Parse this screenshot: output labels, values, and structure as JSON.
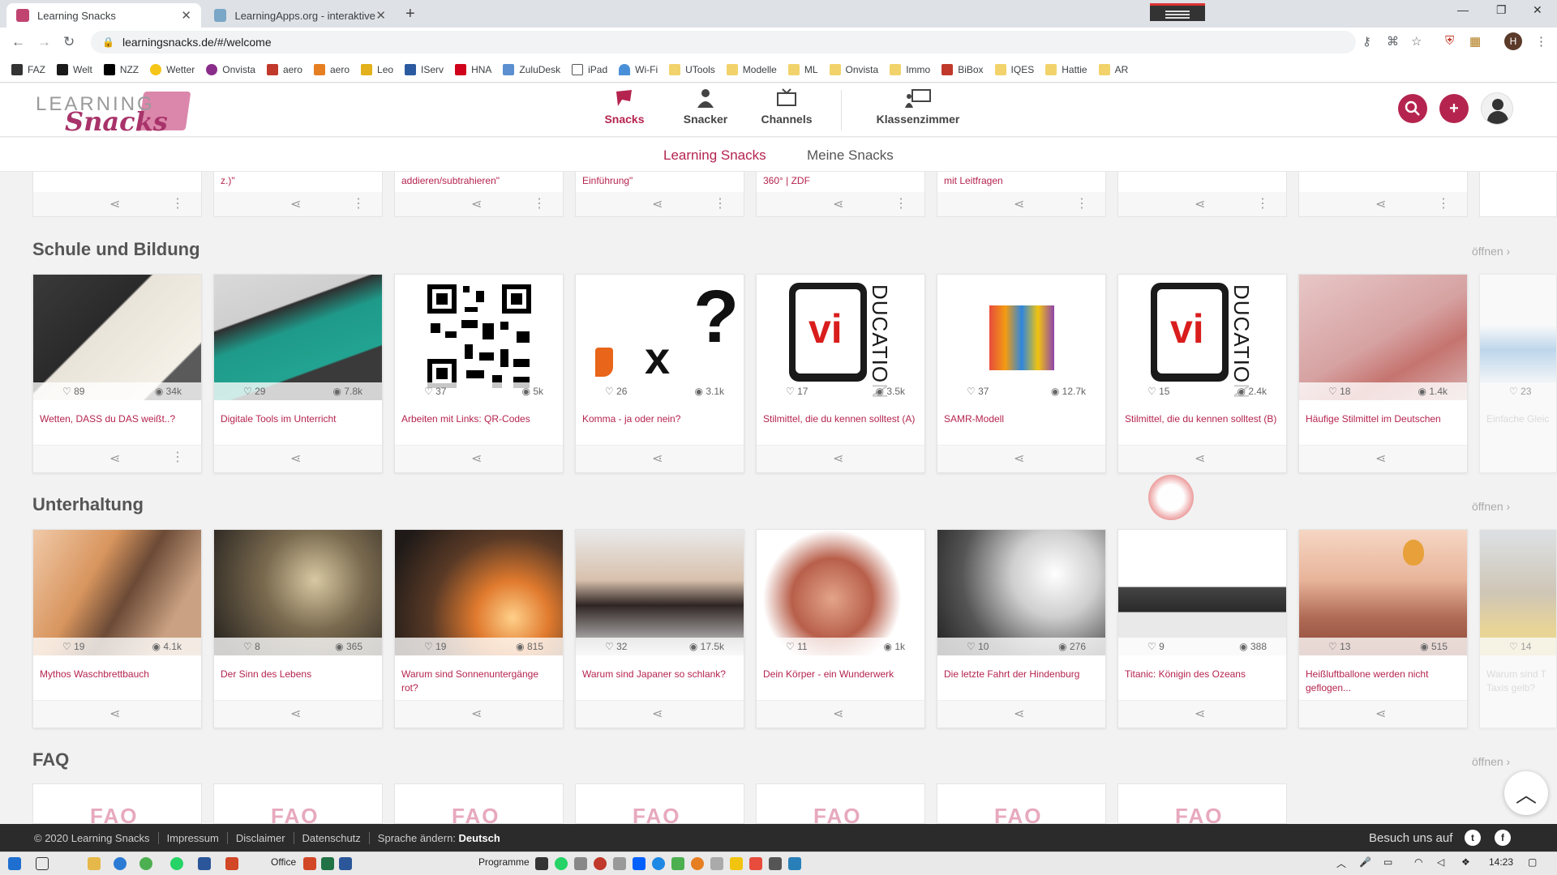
{
  "browser": {
    "tabs": [
      {
        "title": "Learning Snacks",
        "active": true
      },
      {
        "title": "LearningApps.org - interaktive u",
        "active": false
      }
    ],
    "new_tab_icon": "+",
    "url": "learningsnacks.de/#/welcome",
    "profile_initial": "H",
    "bookmarks": [
      "FAZ",
      "Welt",
      "NZZ",
      "Wetter",
      "Onvista",
      "aero",
      "aero",
      "Leo",
      "IServ",
      "HNA",
      "ZuluDesk",
      "iPad",
      "Wi-Fi",
      "UTools",
      "Modelle",
      "ML",
      "Onvista",
      "Immo",
      "BiBox",
      "IQES",
      "Hattie",
      "AR"
    ]
  },
  "site": {
    "logo": {
      "line1": "LEARNING",
      "line2": "Snacks"
    },
    "nav": [
      {
        "label": "Snacks",
        "icon": "snack-icon",
        "active": true
      },
      {
        "label": "Snacker",
        "icon": "person-icon",
        "active": false
      },
      {
        "label": "Channels",
        "icon": "channels-icon",
        "active": false
      },
      {
        "label": "Klassenzimmer",
        "icon": "classroom-icon",
        "active": false
      }
    ],
    "subnav": {
      "primary": "Learning Snacks",
      "secondary": "Meine Snacks"
    },
    "accent_color": "#b5244f"
  },
  "top_row": [
    {
      "title": ""
    },
    {
      "title": "z.)\""
    },
    {
      "title": "addieren/subtrahieren\""
    },
    {
      "title": "Einführung\""
    },
    {
      "title": "360° | ZDF"
    },
    {
      "title": "mit Leitfragen"
    },
    {
      "title": ""
    },
    {
      "title": ""
    }
  ],
  "sections": [
    {
      "title": "Schule und Bildung",
      "more": "öffnen ›",
      "cards": [
        {
          "title": "Wetten, DASS du DAS weißt..?",
          "likes": "89",
          "views": "34k"
        },
        {
          "title": "Digitale Tools im Unterricht",
          "likes": "29",
          "views": "7.8k"
        },
        {
          "title": "Arbeiten mit Links: QR-Codes",
          "likes": "37",
          "views": "5k"
        },
        {
          "title": "Komma - ja oder nein?",
          "likes": "26",
          "views": "3.1k"
        },
        {
          "title": "Stilmittel, die du kennen solltest (A)",
          "likes": "17",
          "views": "3.5k"
        },
        {
          "title": "SAMR-Modell",
          "likes": "37",
          "views": "12.7k"
        },
        {
          "title": "Stilmittel, die du kennen solltest (B)",
          "likes": "15",
          "views": "2.4k"
        },
        {
          "title": "Häufige Stilmittel im Deutschen",
          "likes": "18",
          "views": "1.4k"
        },
        {
          "title": "Einfache Gleic",
          "likes": "23",
          "views": ""
        }
      ]
    },
    {
      "title": "Unterhaltung",
      "more": "öffnen ›",
      "cards": [
        {
          "title": "Mythos Waschbrettbauch",
          "likes": "19",
          "views": "4.1k"
        },
        {
          "title": "Der Sinn des Lebens",
          "likes": "8",
          "views": "365"
        },
        {
          "title": "Warum sind Sonnenuntergänge rot?",
          "likes": "19",
          "views": "815"
        },
        {
          "title": "Warum sind Japaner so schlank?",
          "likes": "32",
          "views": "17.5k"
        },
        {
          "title": "Dein Körper - ein Wunderwerk",
          "likes": "11",
          "views": "1k"
        },
        {
          "title": "Die letzte Fahrt der Hindenburg",
          "likes": "10",
          "views": "276"
        },
        {
          "title": "Titanic: Königin des Ozeans",
          "likes": "9",
          "views": "388"
        },
        {
          "title": "Heißluftballone werden nicht geflogen...",
          "likes": "13",
          "views": "515"
        },
        {
          "title": "Warum sind T Taxis gelb?",
          "likes": "14",
          "views": ""
        }
      ]
    },
    {
      "title": "FAQ",
      "more": "öffnen ›",
      "cards": [
        {
          "title": "FAQ"
        },
        {
          "title": "FAQ"
        },
        {
          "title": "FAQ"
        },
        {
          "title": "FAQ"
        },
        {
          "title": "FAQ"
        },
        {
          "title": "FAQ"
        },
        {
          "title": "FAQ"
        }
      ]
    }
  ],
  "footer": {
    "copyright": "© 2020 Learning Snacks",
    "links": [
      "Impressum",
      "Disclaimer",
      "Datenschutz"
    ],
    "language_label": "Sprache ändern:",
    "language_value": "Deutsch",
    "visit": "Besuch uns auf"
  },
  "taskbar": {
    "office": "Office",
    "programme": "Programme",
    "clock": "14:23"
  }
}
